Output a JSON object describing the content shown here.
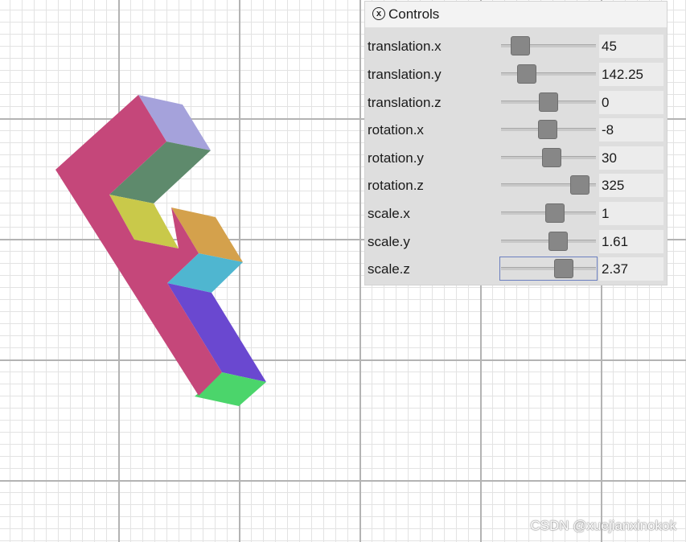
{
  "panel": {
    "close_symbol": "x",
    "title": "Controls"
  },
  "controls": [
    {
      "label": "translation.x",
      "value": "45",
      "fraction": 0.14
    },
    {
      "label": "translation.y",
      "value": "142.25",
      "fraction": 0.22
    },
    {
      "label": "translation.z",
      "value": "0",
      "fraction": 0.5
    },
    {
      "label": "rotation.x",
      "value": "-8",
      "fraction": 0.49
    },
    {
      "label": "rotation.y",
      "value": "30",
      "fraction": 0.54
    },
    {
      "label": "rotation.z",
      "value": "325",
      "fraction": 0.91
    },
    {
      "label": "scale.x",
      "value": "1",
      "fraction": 0.58
    },
    {
      "label": "scale.y",
      "value": "1.61",
      "fraction": 0.63
    },
    {
      "label": "scale.z",
      "value": "2.37",
      "fraction": 0.7,
      "focused": true
    }
  ],
  "shape_colors": {
    "front": "#c5477a",
    "top_cap": "#a5a2db",
    "upper_arm_inner": "#5e8a6c",
    "upper_arm_bottom": "#c9c94a",
    "middle_arm_top": "#d4a14c",
    "middle_arm_inner": "#4fb6d0",
    "stem_side": "#6a48d0",
    "stem_bottom": "#4bd56b"
  },
  "watermark": "CSDN @xuejianxinokok"
}
